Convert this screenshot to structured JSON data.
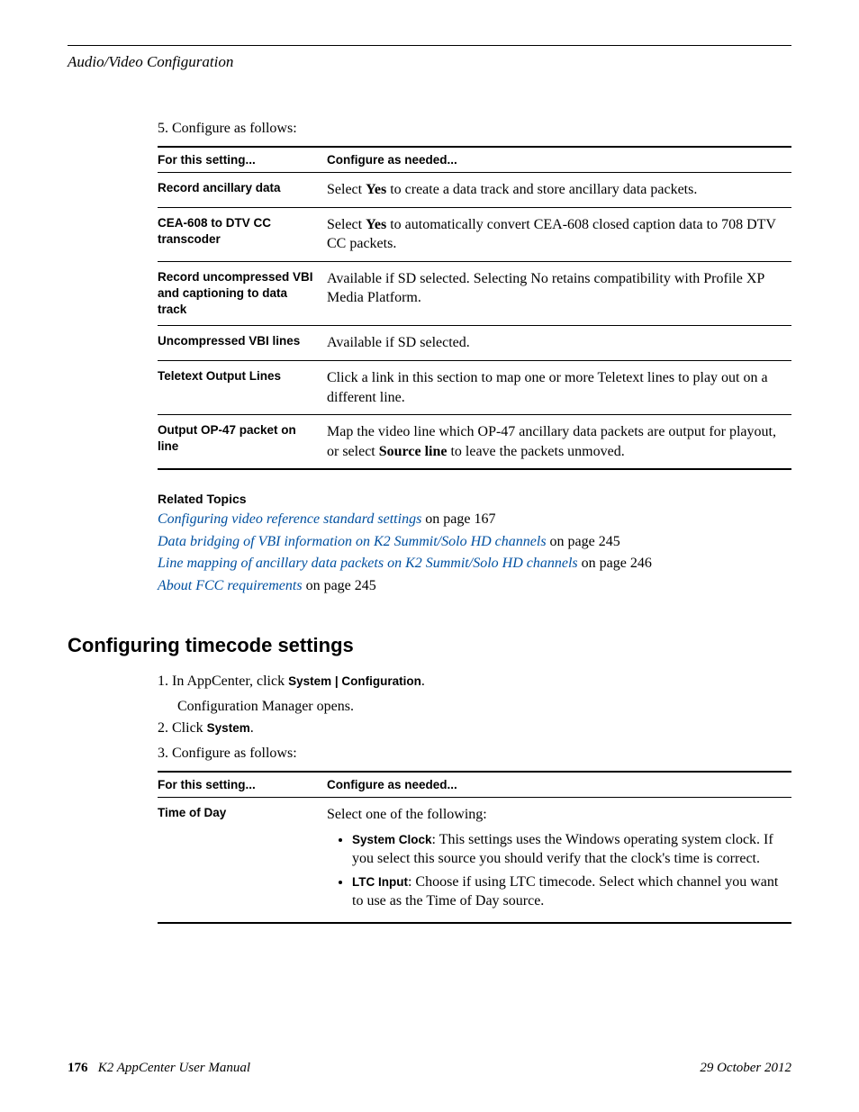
{
  "header": {
    "section_title": "Audio/Video Configuration"
  },
  "step5": {
    "number": "5.",
    "text": "Configure as follows:"
  },
  "table1": {
    "col1": "For this setting...",
    "col2": "Configure as needed...",
    "rows": [
      {
        "setting": "Record ancillary data",
        "desc_pre": "Select ",
        "desc_bold": "Yes",
        "desc_post": " to create a data track and store ancillary data packets."
      },
      {
        "setting": "CEA-608 to DTV CC transcoder",
        "desc_pre": "Select ",
        "desc_bold": "Yes",
        "desc_post": " to automatically convert CEA-608 closed caption data to 708 DTV CC packets."
      },
      {
        "setting": "Record uncompressed VBI and captioning to data track",
        "desc_plain": "Available if SD selected. Selecting No retains compatibility with Profile XP Media Platform."
      },
      {
        "setting": "Uncompressed VBI lines",
        "desc_plain": "Available if SD selected."
      },
      {
        "setting": "Teletext Output Lines",
        "desc_plain": "Click a link in this section to map one or more Teletext lines to play out on a different line."
      },
      {
        "setting": "Output OP-47 packet on line",
        "desc_pre": "Map the video line which OP-47 ancillary data packets are output for playout, or select ",
        "desc_bold": "Source line",
        "desc_post": " to leave the packets unmoved."
      }
    ]
  },
  "related": {
    "heading": "Related Topics",
    "items": [
      {
        "link": "Configuring video reference standard settings",
        "suffix": " on page 167"
      },
      {
        "link": "Data bridging of VBI information on K2 Summit/Solo HD channels",
        "suffix": " on page 245"
      },
      {
        "link": "Line mapping of ancillary data packets on K2 Summit/Solo HD channels",
        "suffix": " on page 246"
      },
      {
        "link": "About FCC requirements",
        "suffix": " on page 245"
      }
    ]
  },
  "section2": {
    "heading": "Configuring timecode settings",
    "step1": {
      "num": "1.",
      "pre": "In AppCenter, click ",
      "b1": "System",
      "sep": " | ",
      "b2": "Configuration",
      "post": "."
    },
    "step1_sub": "Configuration Manager opens.",
    "step2": {
      "num": "2.",
      "pre": "Click ",
      "b1": "System",
      "post": "."
    },
    "step3": {
      "num": "3.",
      "text": "Configure as follows:"
    }
  },
  "table2": {
    "col1": "For this setting...",
    "col2": "Configure as needed...",
    "row": {
      "setting": "Time of Day",
      "intro": "Select one of the following:",
      "bullets": [
        {
          "b": "System Clock",
          "text": ": This settings uses the Windows operating system clock. If you select this source you should verify that the clock's time is correct."
        },
        {
          "b": "LTC Input",
          "text": ": Choose if using LTC timecode. Select which channel you want to use as the Time of Day source."
        }
      ]
    }
  },
  "footer": {
    "page": "176",
    "manual": "K2 AppCenter User Manual",
    "date": "29 October 2012"
  }
}
